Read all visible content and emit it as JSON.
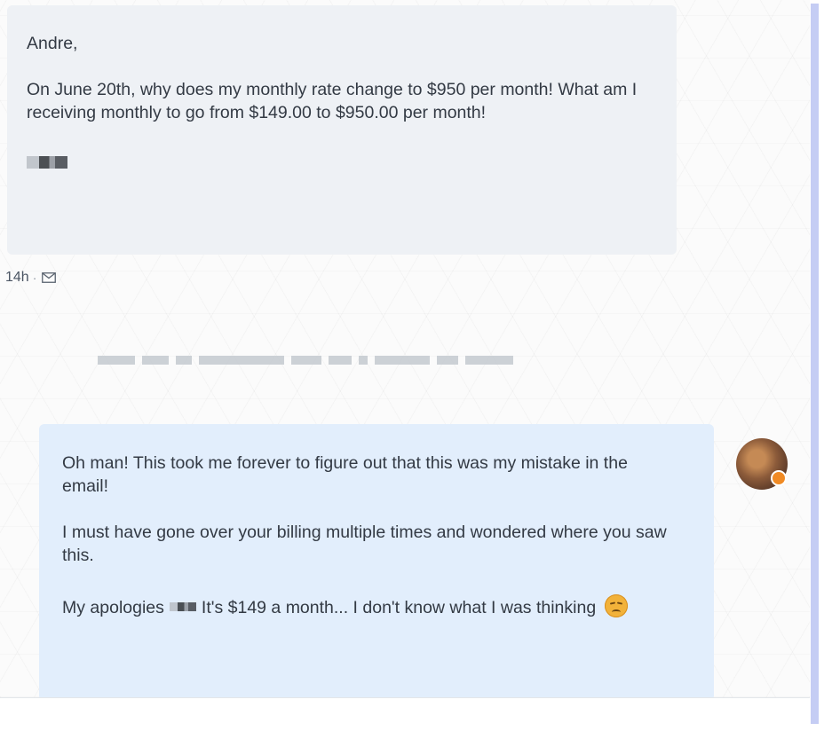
{
  "incoming_message": {
    "greeting": "Andre,",
    "body": "On June 20th, why does my monthly rate change to $950 per month! What am I receiving monthly to go from $149.00 to $950.00 per month!"
  },
  "incoming_meta": {
    "time": "14h",
    "separator": "·",
    "channel_icon": "mail-icon"
  },
  "outgoing_message": {
    "paragraph_1": "Oh man! This took me forever to figure out that this was my mistake in the email!",
    "paragraph_2": "I must have gone over your billing multiple times and wondered where you saw this.",
    "paragraph_3_start": "My apologies",
    "paragraph_3_end": "It's $149 a month... I don't know what I was thinking",
    "emoji": "pensive-face-emoji"
  },
  "colors": {
    "incoming_bubble": "#eef1f5",
    "outgoing_bubble": "#e2eefc",
    "text": "#333a44",
    "scrollbar": "#c5cdf4"
  }
}
